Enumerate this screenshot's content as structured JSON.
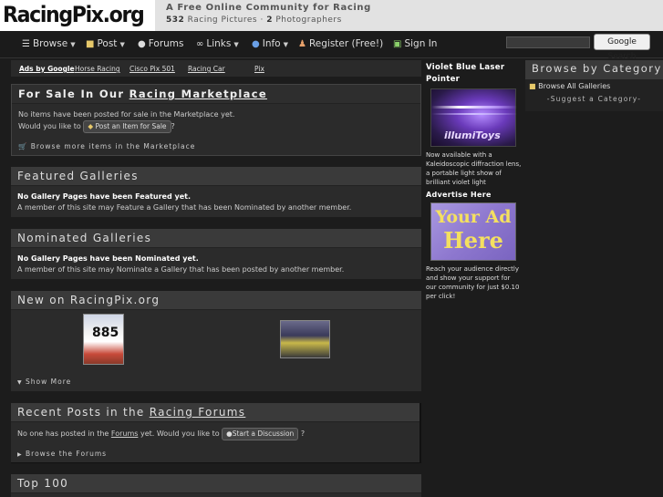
{
  "header": {
    "logo": "RacingPix.org",
    "tagline": "A Free Online Community for Racing",
    "pictures_count": "532",
    "pictures_label": "Racing Pictures",
    "separator": "·",
    "photographers_count": "2",
    "photographers_label": "Photographers"
  },
  "nav": {
    "browse": "Browse",
    "post": "Post",
    "forums": "Forums",
    "links": "Links",
    "info": "Info",
    "register": "Register (Free!)",
    "signin": "Sign In",
    "search_button": "Google Search"
  },
  "ads_bar": {
    "label": "Ads by Google",
    "links": [
      "Horse Racing",
      "Cisco Pix 501",
      "Racing Car",
      "Pix"
    ]
  },
  "marketplace": {
    "title_prefix": "For Sale In Our",
    "title_link": "Racing Marketplace",
    "empty_text": "No items have been posted for sale in the Marketplace yet.",
    "prompt": "Would you like to",
    "button": "Post an Item for Sale",
    "question": "?",
    "footer": "Browse more items in the Marketplace"
  },
  "featured": {
    "title": "Featured Galleries",
    "bold": "No Gallery Pages have been Featured yet.",
    "text": "A member of this site may Feature a Gallery that has been Nominated by another member."
  },
  "nominated": {
    "title": "Nominated Galleries",
    "bold": "No Gallery Pages have been Nominated yet.",
    "text": "A member of this site may Nominate a Gallery that has been posted by another member."
  },
  "new_on": {
    "title": "New on RacingPix.org",
    "show_more": "Show More"
  },
  "recent_posts": {
    "title_prefix": "Recent Posts in the",
    "title_link": "Racing Forums",
    "text_prefix": "No one has posted in the",
    "forums_link": "Forums",
    "text_mid": "yet. Would you like to",
    "button": "Start a Discussion",
    "question": "?",
    "footer": "Browse the Forums"
  },
  "top100": {
    "title": "Top 100"
  },
  "mid_ads": {
    "ad1_title": "Violet Blue Laser Pointer",
    "ad1_text": "Now available with a Kaleidoscopic diffraction lens, a portable light show of brilliant violet light",
    "ad1_banner": "illumiToys",
    "ad2_title": "Advertise Here",
    "ad2_banner_line1": "Your Ad",
    "ad2_banner_line2": "Here",
    "ad2_text": "Reach your audience directly and show your support for our community for just $0.10 per click!"
  },
  "category": {
    "title": "Browse by Category",
    "item": "Browse All Galleries",
    "suggest": "-Suggest a Category-"
  },
  "colors": {
    "background": "#1c1c1c",
    "panel": "#2b2b2b",
    "panel_head": "#3a3a3a",
    "ad_banner": "#8e78cf"
  }
}
